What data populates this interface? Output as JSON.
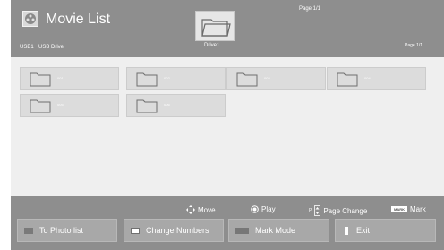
{
  "header": {
    "title": "Movie List",
    "page_top": "Page 1/1",
    "usb_label": "USB1",
    "usb_drive": "USB Drive",
    "drive_name": "Drive1",
    "page_right": "Page 1/1",
    "icon": "movie-reel-icon"
  },
  "folders": [
    {
      "label": "001"
    },
    {
      "label": "002"
    },
    {
      "label": "003"
    },
    {
      "label": "004"
    },
    {
      "label": "005"
    },
    {
      "label": "006"
    }
  ],
  "legend": {
    "move": "Move",
    "play": "Play",
    "page_p": "P",
    "page_change": "Page Change",
    "mark_badge": "MARK",
    "mark": "Mark"
  },
  "buttons": {
    "to_photo_list": "To Photo list",
    "change_numbers": "Change Numbers",
    "mark_mode": "Mark Mode",
    "exit": "Exit"
  },
  "colors": {
    "panel": "#8e8e8e",
    "content": "#efefef",
    "tile": "#dcdcdc"
  }
}
